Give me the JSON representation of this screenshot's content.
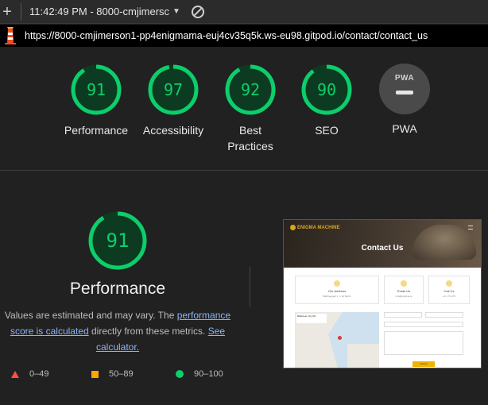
{
  "topbar": {
    "time_report": "11:42:49 PM - 8000-cmjimersc"
  },
  "urlbar": {
    "url": "https://8000-cmjimerson1-pp4enigmama-euj4cv35q5k.ws-eu98.gitpod.io/contact/contact_us"
  },
  "colors": {
    "pass": "#0cce6b",
    "pass_bg": "#0c3b22",
    "average": "#ffa400",
    "fail": "#ff4e42",
    "link": "#8ab4f8"
  },
  "categories": [
    {
      "score": "91",
      "label": "Performance",
      "fraction": 0.91
    },
    {
      "score": "97",
      "label": "Accessibility",
      "fraction": 0.97
    },
    {
      "score": "92",
      "label": "Best Practices",
      "fraction": 0.92
    },
    {
      "score": "90",
      "label": "SEO",
      "fraction": 0.9
    }
  ],
  "pwa": {
    "badge_text": "PWA",
    "label": "PWA"
  },
  "performance": {
    "score": "91",
    "fraction": 0.91,
    "title": "Performance",
    "desc_1": "Values are estimated and may vary. The ",
    "link_1": "performance score is calculated",
    "desc_2": " directly from these metrics. ",
    "link_2": "See calculator."
  },
  "legend": [
    {
      "icon": "triangle-icon",
      "range": "0–49"
    },
    {
      "icon": "square-icon",
      "range": "50–89"
    },
    {
      "icon": "circle-icon",
      "range": "90–100"
    }
  ],
  "screenshot": {
    "logo": "ENIGMA MACHINE",
    "hero_title": "Contact Us",
    "cards": [
      {
        "title": "Our Address",
        "sub": "Ballinteggart 1, 1 12 Berlin"
      },
      {
        "title": "Email Us",
        "sub": "info@enigma.ie"
      },
      {
        "title": "Call Us",
        "sub": "+0 1 79 475"
      }
    ],
    "map_info": "Ballinteer City Rd",
    "send": "Submit"
  }
}
